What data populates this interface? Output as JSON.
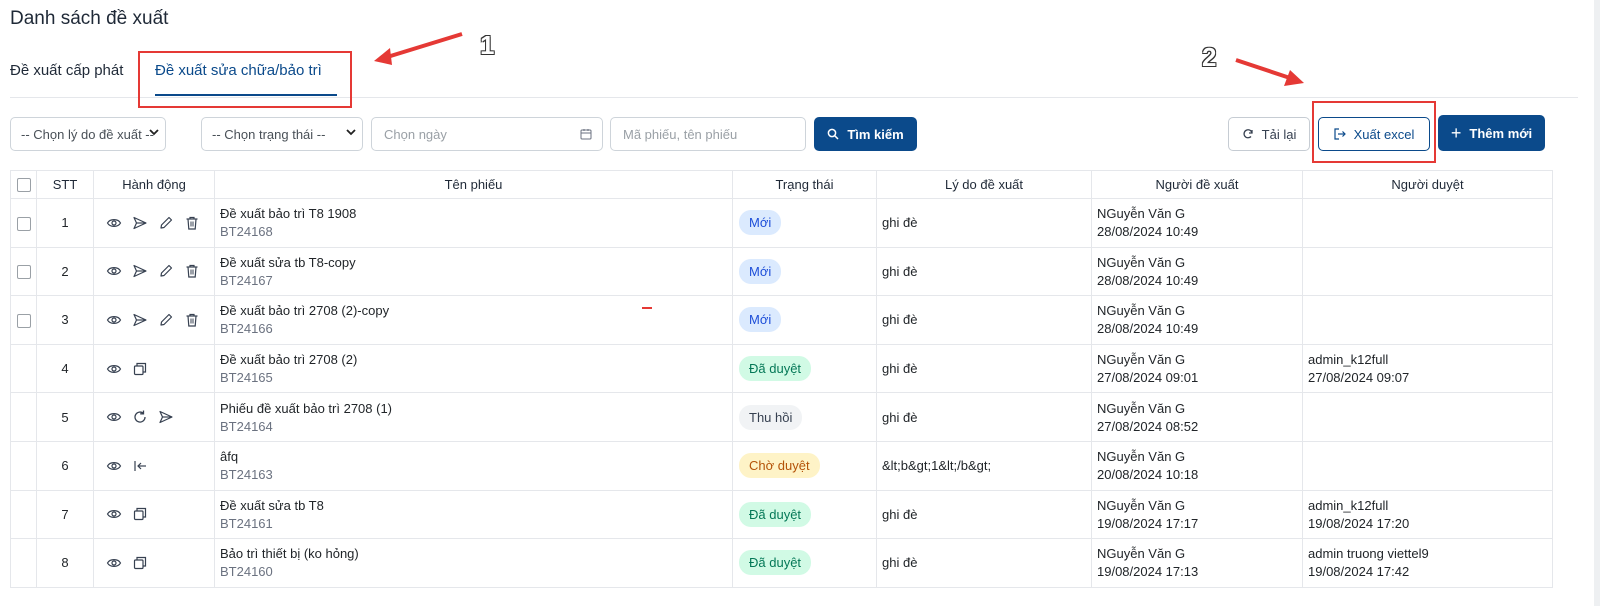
{
  "page": {
    "title": "Danh sách đề xuất"
  },
  "tabs": [
    {
      "label": "Đề xuất cấp phát"
    },
    {
      "label": "Đề xuất sửa chữa/bảo trì"
    }
  ],
  "filters": {
    "reason_select": "-- Chọn lý do đề xuất --",
    "status_select": "-- Chọn trạng thái --",
    "date_placeholder": "Chọn ngày",
    "keyword_placeholder": "Mã phiếu, tên phiếu",
    "search_button": "Tìm kiếm"
  },
  "toolbar": {
    "reload_button": "Tải lại",
    "export_button": "Xuất excel",
    "add_button": "Thêm mới"
  },
  "table": {
    "headers": [
      "STT",
      "Hành động",
      "Tên phiếu",
      "Trạng thái",
      "Lý do đề xuất",
      "Người đề xuất",
      "Người duyệt"
    ],
    "rows": [
      {
        "stt": "1",
        "name": "Đề xuất bảo trì T8 1908",
        "code": "BT24168",
        "status": "Mới",
        "reason": "ghi đè",
        "proposer": "NGuyễn Văn G",
        "proposed_at": "28/08/2024 10:49",
        "approver": "",
        "approved_at": ""
      },
      {
        "stt": "2",
        "name": "Đề xuất sửa tb T8-copy",
        "code": "BT24167",
        "status": "Mới",
        "reason": "ghi đè",
        "proposer": "NGuyễn Văn G",
        "proposed_at": "28/08/2024 10:49",
        "approver": "",
        "approved_at": ""
      },
      {
        "stt": "3",
        "name": "Đề xuất bảo trì 2708 (2)-copy",
        "code": "BT24166",
        "status": "Mới",
        "reason": "ghi đè",
        "proposer": "NGuyễn Văn G",
        "proposed_at": "28/08/2024 10:49",
        "approver": "",
        "approved_at": ""
      },
      {
        "stt": "4",
        "name": "Đề xuất bảo trì 2708 (2)",
        "code": "BT24165",
        "status": "Đã duyệt",
        "reason": "ghi đè",
        "proposer": "NGuyễn Văn G",
        "proposed_at": "27/08/2024 09:01",
        "approver": "admin_k12full",
        "approved_at": "27/08/2024 09:07"
      },
      {
        "stt": "5",
        "name": "Phiếu đề xuất bảo trì 2708 (1)",
        "code": "BT24164",
        "status": "Thu hồi",
        "reason": "ghi đè",
        "proposer": "NGuyễn Văn G",
        "proposed_at": "27/08/2024 08:52",
        "approver": "",
        "approved_at": ""
      },
      {
        "stt": "6",
        "name": "âfq",
        "code": "BT24163",
        "status": "Chờ duyệt",
        "reason": "&lt;b&gt;1&lt;/b&gt;",
        "proposer": "NGuyễn Văn G",
        "proposed_at": "20/08/2024 10:18",
        "approver": "",
        "approved_at": ""
      },
      {
        "stt": "7",
        "name": "Đề xuất sửa tb T8",
        "code": "BT24161",
        "status": "Đã duyệt",
        "reason": "ghi đè",
        "proposer": "NGuyễn Văn G",
        "proposed_at": "19/08/2024 17:17",
        "approver": "admin_k12full",
        "approved_at": "19/08/2024 17:20"
      },
      {
        "stt": "8",
        "name": "Bảo trì thiết bị (ko hỏng)",
        "code": "BT24160",
        "status": "Đã duyệt",
        "reason": "ghi đè",
        "proposer": "NGuyễn Văn G",
        "proposed_at": "19/08/2024 17:13",
        "approver": "admin truong viettel9",
        "approved_at": "19/08/2024 17:42"
      }
    ]
  },
  "annotations": {
    "first": "1",
    "second": "2"
  },
  "colors": {
    "primary": "#0b4a8b",
    "annotation": "#e53935"
  }
}
